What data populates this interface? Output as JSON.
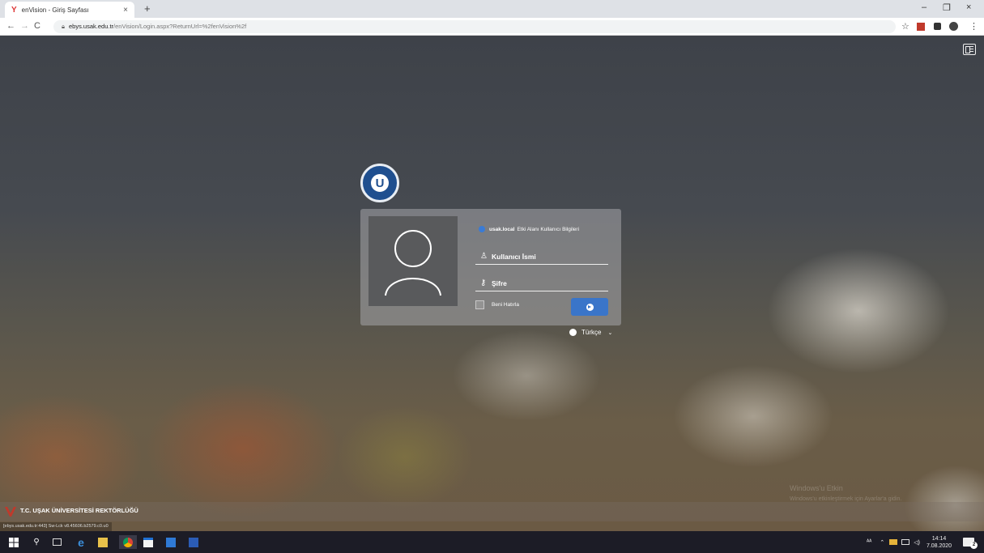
{
  "browser": {
    "tab_title": "enVision - Giriş Sayfası",
    "tab_close": "×",
    "new_tab": "+",
    "url_host": "ebys.usak.edu.tr",
    "url_path": "/enVision/Login.aspx?ReturnUrl=%2fenVision%2f",
    "minimize": "–",
    "restore": "❐",
    "close": "×",
    "nav_back": "←",
    "nav_forward": "→",
    "nav_reload": "C",
    "star": "☆",
    "menu": "⋮"
  },
  "login": {
    "domain_name": "usak.local",
    "domain_label": "Etki Alanı Kullanıcı Bilgileri",
    "username_placeholder": "Kullanıcı İsmi",
    "password_placeholder": "Şifre",
    "remember_label": "Beni Hatırla",
    "language": "Türkçe"
  },
  "footer": {
    "institution": "T.C. UŞAK ÜNİVERSİTESİ REKTÖRLÜĞÜ",
    "status_url": "[ebys.usak.edu.tr:443] Sw-Lck v8.45606.b2579.c0.u0"
  },
  "watermark": {
    "title": "Windows'u Etkin",
    "subtitle": "Windows'u etkinleştirmek için Ayarlar'a gidin."
  },
  "taskbar": {
    "time": "14:14",
    "date": "7.08.2020",
    "notification_count": "2",
    "lang_glyph": "ᴬᴬ"
  },
  "colors": {
    "accent": "#3a75c9",
    "logo_blue": "#1f4f8f",
    "taskbar": "#1c1c26"
  }
}
